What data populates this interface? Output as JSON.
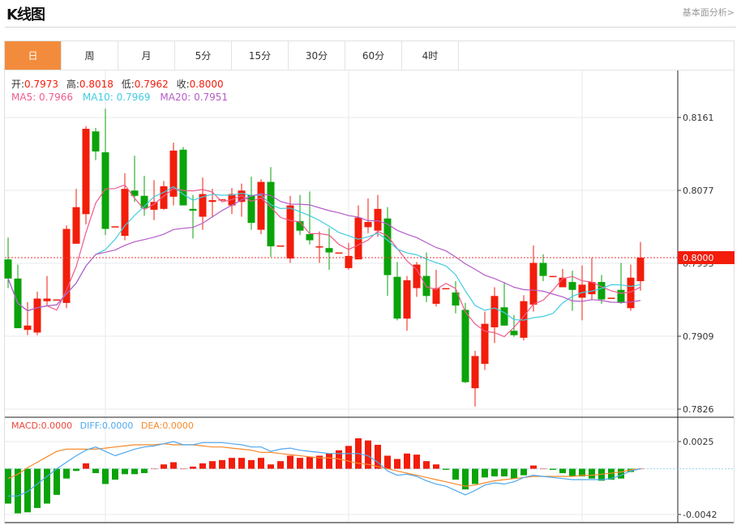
{
  "header": {
    "title": "K线图",
    "link": "基本面分析>"
  },
  "tabs": [
    {
      "label": "日",
      "active": true
    },
    {
      "label": "周"
    },
    {
      "label": "月"
    },
    {
      "label": "5分"
    },
    {
      "label": "15分"
    },
    {
      "label": "30分"
    },
    {
      "label": "60分"
    },
    {
      "label": "4时"
    }
  ],
  "ohlc_legend": {
    "open_label": "开:",
    "open": "0.7973",
    "high_label": "高:",
    "high": "0.8018",
    "low_label": "低:",
    "low": "0.7962",
    "close_label": "收:",
    "close": "0.8000"
  },
  "ma_legend": {
    "ma5": "MA5: 0.7966",
    "ma10": "MA10: 0.7969",
    "ma20": "MA20: 0.7951"
  },
  "macd_legend": {
    "macd": "MACD:0.0000",
    "diff": "DIFF:0.0000",
    "dea": "DEA:0.0000"
  },
  "colors": {
    "up": "#f21d0b",
    "down": "#0aa30a",
    "ma5": "#ef5b8d",
    "ma10": "#41cde0",
    "ma20": "#b45cc9",
    "diff": "#4ea8ee",
    "dea": "#f7892c",
    "accent": "#f28c3c"
  },
  "chart_data": [
    {
      "type": "candlestick",
      "y_ticks": [
        "0.8161",
        "0.8077",
        "0.7993",
        "0.7909",
        "0.7826"
      ],
      "current_price": "0.8000",
      "ohlc": [
        [
          0.7998,
          0.8023,
          0.7965,
          0.7976
        ],
        [
          0.7976,
          0.7992,
          0.7919,
          0.7919
        ],
        [
          0.7917,
          0.7949,
          0.7911,
          0.7922
        ],
        [
          0.7914,
          0.7961,
          0.7911,
          0.7953
        ],
        [
          0.795,
          0.7979,
          0.7945,
          0.7953
        ],
        [
          0.7952,
          0.7952,
          0.7952,
          0.7952
        ],
        [
          0.7948,
          0.8037,
          0.7942,
          0.8033
        ],
        [
          0.8016,
          0.8079,
          0.8016,
          0.8058
        ],
        [
          0.805,
          0.8151,
          0.8038,
          0.8148
        ],
        [
          0.8145,
          0.8149,
          0.8112,
          0.8122
        ],
        [
          0.8121,
          0.8171,
          0.8026,
          0.8033
        ],
        [
          0.8036,
          0.8036,
          0.8036,
          0.8036
        ],
        [
          0.8025,
          0.8097,
          0.802,
          0.8079
        ],
        [
          0.8077,
          0.8117,
          0.8064,
          0.8071
        ],
        [
          0.8071,
          0.8094,
          0.8048,
          0.8057
        ],
        [
          0.8055,
          0.8089,
          0.8043,
          0.8064
        ],
        [
          0.8056,
          0.8088,
          0.8055,
          0.8082
        ],
        [
          0.807,
          0.8132,
          0.806,
          0.8123
        ],
        [
          0.8124,
          0.8127,
          0.806,
          0.806
        ],
        [
          0.8056,
          0.8072,
          0.8022,
          0.8054
        ],
        [
          0.8047,
          0.8092,
          0.8032,
          0.8073
        ],
        [
          0.8064,
          0.8079,
          0.8046,
          0.8066
        ],
        [
          0.8067,
          0.8067,
          0.8067,
          0.8067
        ],
        [
          0.806,
          0.808,
          0.805,
          0.8073
        ],
        [
          0.8064,
          0.8085,
          0.8047,
          0.8077
        ],
        [
          0.8072,
          0.8093,
          0.8032,
          0.804
        ],
        [
          0.8032,
          0.809,
          0.8027,
          0.8087
        ],
        [
          0.8087,
          0.8104,
          0.8001,
          0.8013
        ],
        [
          0.8014,
          0.8014,
          0.8014,
          0.8014
        ],
        [
          0.7999,
          0.8071,
          0.7994,
          0.806
        ],
        [
          0.8042,
          0.8072,
          0.8026,
          0.8031
        ],
        [
          0.8027,
          0.8076,
          0.8015,
          0.802
        ],
        [
          0.8013,
          0.803,
          0.7994,
          0.8013
        ],
        [
          0.8011,
          0.8034,
          0.7986,
          0.8006
        ],
        [
          0.8006,
          0.8006,
          0.8006,
          0.8006
        ],
        [
          0.7988,
          0.8017,
          0.7986,
          0.8002
        ],
        [
          0.7998,
          0.806,
          0.7998,
          0.8046
        ],
        [
          0.8035,
          0.8068,
          0.8028,
          0.8041
        ],
        [
          0.8031,
          0.8072,
          0.8024,
          0.8056
        ],
        [
          0.8045,
          0.8058,
          0.7956,
          0.798
        ],
        [
          0.7978,
          0.7995,
          0.7928,
          0.793
        ],
        [
          0.793,
          0.7979,
          0.7916,
          0.7974
        ],
        [
          0.7965,
          0.7995,
          0.7955,
          0.7992
        ],
        [
          0.7979,
          0.8006,
          0.7949,
          0.7956
        ],
        [
          0.7947,
          0.7986,
          0.7944,
          0.7965
        ],
        [
          0.7965,
          0.7965,
          0.7965,
          0.7965
        ],
        [
          0.796,
          0.7973,
          0.7936,
          0.7945
        ],
        [
          0.794,
          0.7948,
          0.7856,
          0.7857
        ],
        [
          0.785,
          0.7893,
          0.7829,
          0.7887
        ],
        [
          0.7878,
          0.7938,
          0.7871,
          0.7924
        ],
        [
          0.792,
          0.7966,
          0.7902,
          0.7956
        ],
        [
          0.7943,
          0.7972,
          0.7922,
          0.7922
        ],
        [
          0.7916,
          0.7934,
          0.7909,
          0.7911
        ],
        [
          0.7908,
          0.7957,
          0.7905,
          0.795
        ],
        [
          0.7946,
          0.8014,
          0.7938,
          0.7994
        ],
        [
          0.7994,
          0.8004,
          0.7973,
          0.7979
        ],
        [
          0.7979,
          0.7979,
          0.7979,
          0.7979
        ],
        [
          0.7966,
          0.7987,
          0.7966,
          0.7977
        ],
        [
          0.7972,
          0.7985,
          0.7939,
          0.7963
        ],
        [
          0.7954,
          0.7991,
          0.7928,
          0.7969
        ],
        [
          0.7958,
          0.8,
          0.7951,
          0.7972
        ],
        [
          0.7972,
          0.798,
          0.7947,
          0.7952
        ],
        [
          0.7954,
          0.7954,
          0.7954,
          0.7954
        ],
        [
          0.7963,
          0.7994,
          0.7947,
          0.7948
        ],
        [
          0.7942,
          0.7992,
          0.7939,
          0.7977
        ],
        [
          0.7973,
          0.8018,
          0.7962,
          0.8
        ]
      ],
      "ma_periods": [
        5,
        10,
        20
      ],
      "grid": true
    },
    {
      "type": "bar+line",
      "y_ticks": [
        "0.0025",
        "-0.0042"
      ],
      "macd": [
        -0.0032,
        -0.0041,
        -0.004,
        -0.0036,
        -0.0032,
        -0.0024,
        -0.0009,
        -0.0002,
        0.0005,
        -0.0004,
        -0.0014,
        -0.001,
        -0.0005,
        -0.0005,
        -0.0004,
        0,
        0.0004,
        0.0006,
        0,
        0.0002,
        0.0005,
        0.0007,
        0.0008,
        0.001,
        0.001,
        0.0008,
        0.001,
        0.0004,
        0.0007,
        0.0012,
        0.001,
        0.0011,
        0.0012,
        0.0014,
        0.0017,
        0.0021,
        0.0028,
        0.0026,
        0.0022,
        0.0012,
        0.0009,
        0.0014,
        0.0013,
        0.0007,
        0.0004,
        -0.0001,
        -0.001,
        -0.0019,
        -0.0014,
        -0.0008,
        -0.0007,
        -0.0007,
        -0.0009,
        -0.0006,
        0.0003,
        0.0,
        -0.0001,
        -0.0004,
        -0.0007,
        -0.0007,
        -0.0009,
        -0.0011,
        -0.001,
        -0.0009,
        -0.0003,
        0
      ],
      "diff": [
        -0.0025,
        -0.0025,
        -0.0021,
        -0.0014,
        -0.0007,
        0,
        0.0006,
        0.0012,
        0.0017,
        0.002,
        0.0016,
        0.0012,
        0.0015,
        0.0018,
        0.002,
        0.0021,
        0.0023,
        0.0025,
        0.0022,
        0.0022,
        0.0024,
        0.0024,
        0.0024,
        0.0023,
        0.0022,
        0.002,
        0.002,
        0.0016,
        0.0018,
        0.0019,
        0.0017,
        0.0016,
        0.0015,
        0.0014,
        0.0014,
        0.0014,
        0.0014,
        0.0012,
        0.0006,
        -0.0002,
        -0.0006,
        -0.0005,
        -0.0007,
        -0.0011,
        -0.0014,
        -0.0016,
        -0.002,
        -0.0024,
        -0.002,
        -0.0015,
        -0.0013,
        -0.0014,
        -0.0012,
        -0.0008,
        -0.0006,
        -0.0007,
        -0.0008,
        -0.0009,
        -0.001,
        -0.001,
        -0.001,
        -0.001,
        -0.0009,
        -0.0006,
        -0.0002,
        0
      ],
      "dea": [
        -0.0009,
        -0.0005,
        0.0001,
        0.0006,
        0.0011,
        0.0016,
        0.0018,
        0.0018,
        0.0018,
        0.0018,
        0.0019,
        0.002,
        0.0021,
        0.0022,
        0.0022,
        0.0022,
        0.0023,
        0.0022,
        0.0022,
        0.0022,
        0.0021,
        0.002,
        0.002,
        0.0019,
        0.0018,
        0.0017,
        0.0015,
        0.0015,
        0.0014,
        0.0013,
        0.0012,
        0.0011,
        0.001,
        0.001,
        0.0009,
        0.0007,
        0.0005,
        0.0004,
        0.0002,
        0,
        -0.0002,
        -0.0004,
        -0.0006,
        -0.0008,
        -0.001,
        -0.0012,
        -0.0014,
        -0.0016,
        -0.0015,
        -0.0013,
        -0.0011,
        -0.001,
        -0.0009,
        -0.0008,
        -0.0007,
        -0.0007,
        -0.0007,
        -0.0007,
        -0.0007,
        -0.0006,
        -0.0006,
        -0.0005,
        -0.0004,
        -0.0003,
        -0.0001,
        0
      ]
    }
  ]
}
